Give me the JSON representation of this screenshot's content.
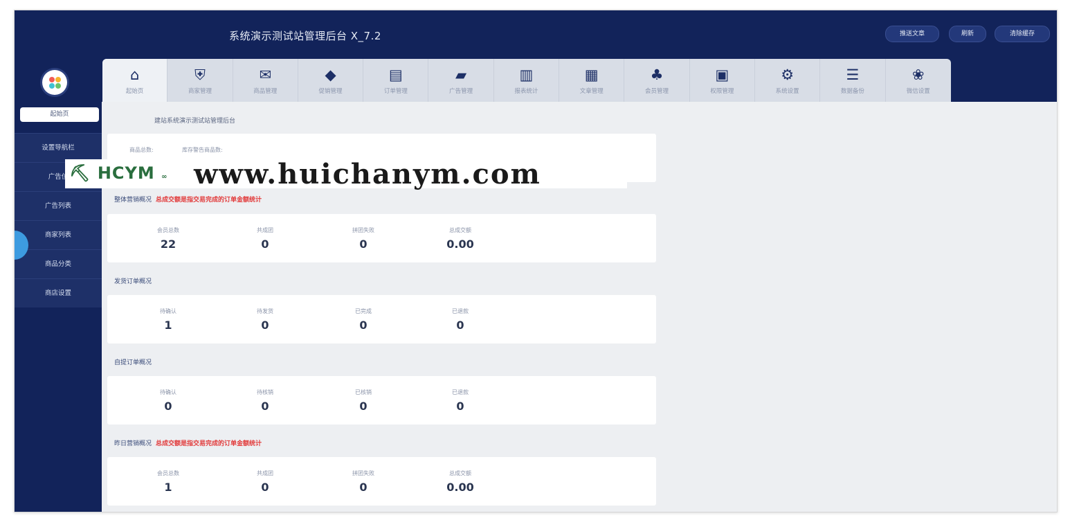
{
  "header": {
    "title": "系统演示测试站管理后台 X_7.2",
    "buttons": [
      "推送文章",
      "刷新",
      "清除缓存"
    ]
  },
  "nav_tabs": [
    {
      "label": "起始页",
      "icon": "home-icon",
      "glyph": "⌂"
    },
    {
      "label": "商家管理",
      "icon": "shield-icon",
      "glyph": "⛨"
    },
    {
      "label": "商品管理",
      "icon": "inbox-icon",
      "glyph": "✉"
    },
    {
      "label": "促销管理",
      "icon": "tag-icon",
      "glyph": "◆"
    },
    {
      "label": "订单管理",
      "icon": "clipboard-icon",
      "glyph": "▤"
    },
    {
      "label": "广告管理",
      "icon": "megaphone-icon",
      "glyph": "▰"
    },
    {
      "label": "报表统计",
      "icon": "bar-chart-icon",
      "glyph": "▥"
    },
    {
      "label": "文章管理",
      "icon": "document-icon",
      "glyph": "▦"
    },
    {
      "label": "会员管理",
      "icon": "users-icon",
      "glyph": "♣"
    },
    {
      "label": "权限管理",
      "icon": "lock-icon",
      "glyph": "▣"
    },
    {
      "label": "系统设置",
      "icon": "gears-icon",
      "glyph": "⚙"
    },
    {
      "label": "数据备份",
      "icon": "database-icon",
      "glyph": "☰"
    },
    {
      "label": "微信设置",
      "icon": "wechat-icon",
      "glyph": "❀"
    }
  ],
  "sidebar": {
    "active": "起始页",
    "items": [
      "设置导航栏",
      "广告位",
      "广告列表",
      "商家列表",
      "商品分类",
      "商店设置"
    ]
  },
  "breadcrumb": "建站系统演示测试站管理后台",
  "goods": {
    "labels": [
      "商品总数:",
      "库存警告商品数:"
    ]
  },
  "overall": {
    "title": "整体营销概况",
    "note": "总成交额是指交易完成的订单金额统计",
    "stats": [
      {
        "label": "会员总数",
        "value": "22"
      },
      {
        "label": "共成团",
        "value": "0"
      },
      {
        "label": "拼团失败",
        "value": "0"
      },
      {
        "label": "总成交额",
        "value": "0.00"
      }
    ]
  },
  "delivery": {
    "title": "发货订单概况",
    "stats": [
      {
        "label": "待确认",
        "value": "1"
      },
      {
        "label": "待发货",
        "value": "0"
      },
      {
        "label": "已完成",
        "value": "0"
      },
      {
        "label": "已退款",
        "value": "0"
      }
    ]
  },
  "pickup": {
    "title": "自提订单概况",
    "stats": [
      {
        "label": "待确认",
        "value": "0"
      },
      {
        "label": "待核销",
        "value": "0"
      },
      {
        "label": "已核销",
        "value": "0"
      },
      {
        "label": "已退款",
        "value": "0"
      }
    ]
  },
  "yesterday": {
    "title": "昨日营销概况",
    "note": "总成交额是指交易完成的订单金额统计",
    "stats": [
      {
        "label": "会员总数",
        "value": "1"
      },
      {
        "label": "共成团",
        "value": "0"
      },
      {
        "label": "拼团失败",
        "value": "0"
      },
      {
        "label": "总成交额",
        "value": "0.00"
      }
    ]
  },
  "watermark": {
    "logo": "HCYM",
    "url": "www.huichanym.com"
  },
  "colors": {
    "navy": "#12235a",
    "accent_red": "#e23b3b",
    "bubble": "#3d9be0"
  }
}
